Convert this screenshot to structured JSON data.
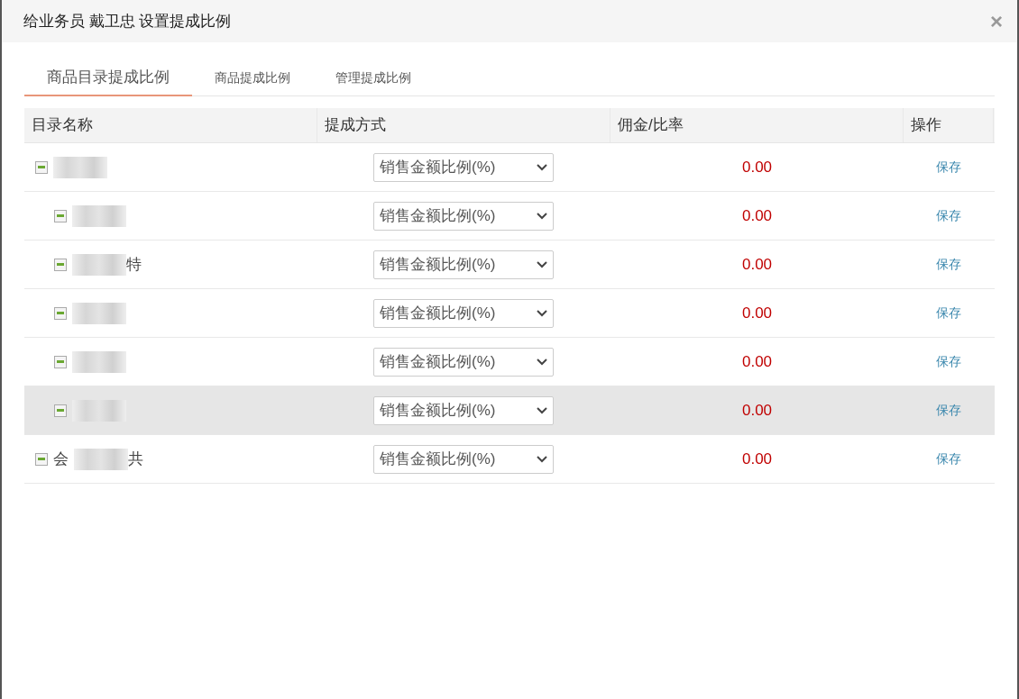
{
  "dialog": {
    "title": "给业务员 戴卫忠 设置提成比例",
    "close": "×"
  },
  "tabs": [
    {
      "label": "商品目录提成比例",
      "selected": true
    },
    {
      "label": "商品提成比例",
      "selected": false
    },
    {
      "label": "管理提成比例",
      "selected": false
    }
  ],
  "table": {
    "columns": [
      "目录名称",
      "提成方式",
      "佣金/比率",
      "操作"
    ],
    "rows": [
      {
        "expanded": true,
        "method": "销售金额比例(%)",
        "rate": "0.00",
        "action": "保存",
        "selected": false,
        "children": [
          {
            "expanded": true,
            "method": "销售金额比例(%)",
            "rate": "0.00",
            "action": "保存",
            "selected": false
          },
          {
            "name_after": "特",
            "expanded": true,
            "method": "销售金额比例(%)",
            "rate": "0.00",
            "action": "保存",
            "selected": false
          },
          {
            "expanded": true,
            "method": "销售金额比例(%)",
            "rate": "0.00",
            "action": "保存",
            "selected": false
          },
          {
            "expanded": true,
            "method": "销售金额比例(%)",
            "rate": "0.00",
            "action": "保存",
            "selected": false
          },
          {
            "expanded": true,
            "method": "销售金额比例(%)",
            "rate": "0.00",
            "action": "保存",
            "selected": true
          }
        ]
      },
      {
        "name_before": "会",
        "name_after": "共",
        "expanded": true,
        "method": "销售金额比例(%)",
        "rate": "0.00",
        "action": "保存",
        "selected": false
      }
    ]
  }
}
